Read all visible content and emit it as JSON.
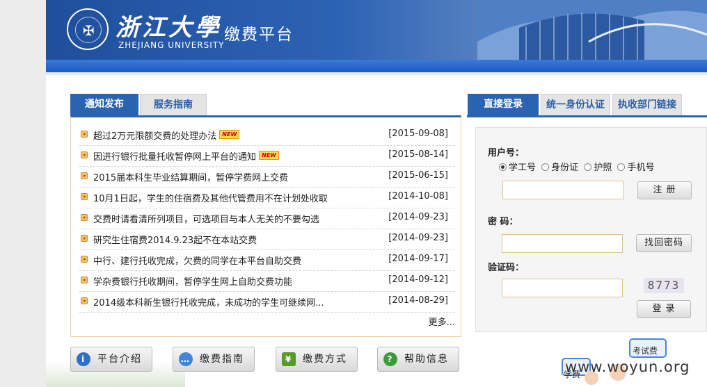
{
  "header": {
    "university_cn": "浙江大學",
    "university_en": "ZHEJIANG UNIVERSITY",
    "platform_title": "缴费平台"
  },
  "news_tabs": [
    {
      "label": "通知发布",
      "active": true
    },
    {
      "label": "服务指南",
      "active": false
    }
  ],
  "news": {
    "items": [
      {
        "title": "超过2万元限额交费的处理办法",
        "date": "[2015-09-08]",
        "new": true
      },
      {
        "title": "因进行银行批量托收暂停网上平台的通知",
        "date": "[2015-08-14]",
        "new": true
      },
      {
        "title": "2015届本科生毕业结算期间，暂停学费网上交费",
        "date": "[2015-06-15]",
        "new": false
      },
      {
        "title": "10月1日起，学生的住宿费及其他代管费用不在计划处收取",
        "date": "[2014-10-08]",
        "new": false
      },
      {
        "title": "交费时请看清所列项目，可选项目与本人无关的不要勾选",
        "date": "[2014-09-23]",
        "new": false
      },
      {
        "title": "研究生住宿费2014.9.23起不在本站交费",
        "date": "[2014-09-23]",
        "new": false
      },
      {
        "title": "中行、建行托收完成，欠费的同学在本平台自助交费",
        "date": "[2014-09-17]",
        "new": false
      },
      {
        "title": "学杂费银行托收期间，暂停学生网上自助交费功能",
        "date": "[2014-09-12]",
        "new": false
      },
      {
        "title": "2014级本科新生银行托收完成，未成功的学生可继续网...",
        "date": "[2014-08-29]",
        "new": false
      }
    ],
    "new_badge": "NEW",
    "more": "更多..."
  },
  "login_tabs": [
    {
      "label": "直接登录",
      "active": true
    },
    {
      "label": "统一身份认证",
      "active": false
    },
    {
      "label": "执收部门链接",
      "active": false
    }
  ],
  "login": {
    "username_label": "用户号：",
    "id_types": [
      "学工号",
      "身份证",
      "护照",
      "手机号"
    ],
    "selected_id_type": "学工号",
    "username_value": "",
    "register_btn": "注 册",
    "password_label": "密 码：",
    "password_value": "",
    "recover_btn": "找回密码",
    "captcha_label": "验证码：",
    "captcha_value": "",
    "captcha_image_text": "8773",
    "login_btn": "登 录"
  },
  "bottom_buttons": [
    {
      "label": "平台介绍",
      "icon": "info-icon",
      "color": "#2f6fc6"
    },
    {
      "label": "缴费指南",
      "icon": "chat-bubble-icon",
      "color": "#3f86d6"
    },
    {
      "label": "缴费方式",
      "icon": "cash-register-icon",
      "color": "#5a9a2a"
    },
    {
      "label": "帮助信息",
      "icon": "question-icon",
      "color": "#3c9a3c"
    }
  ],
  "decor": {
    "kaoshi_label": "考试费",
    "xuefei_label": "学费"
  },
  "watermark": "www.woyun.org",
  "colors": {
    "header_blue": "#1f4f9c",
    "tab_active": "#2a63b2",
    "tab_inactive_text": "#2a5da6"
  }
}
